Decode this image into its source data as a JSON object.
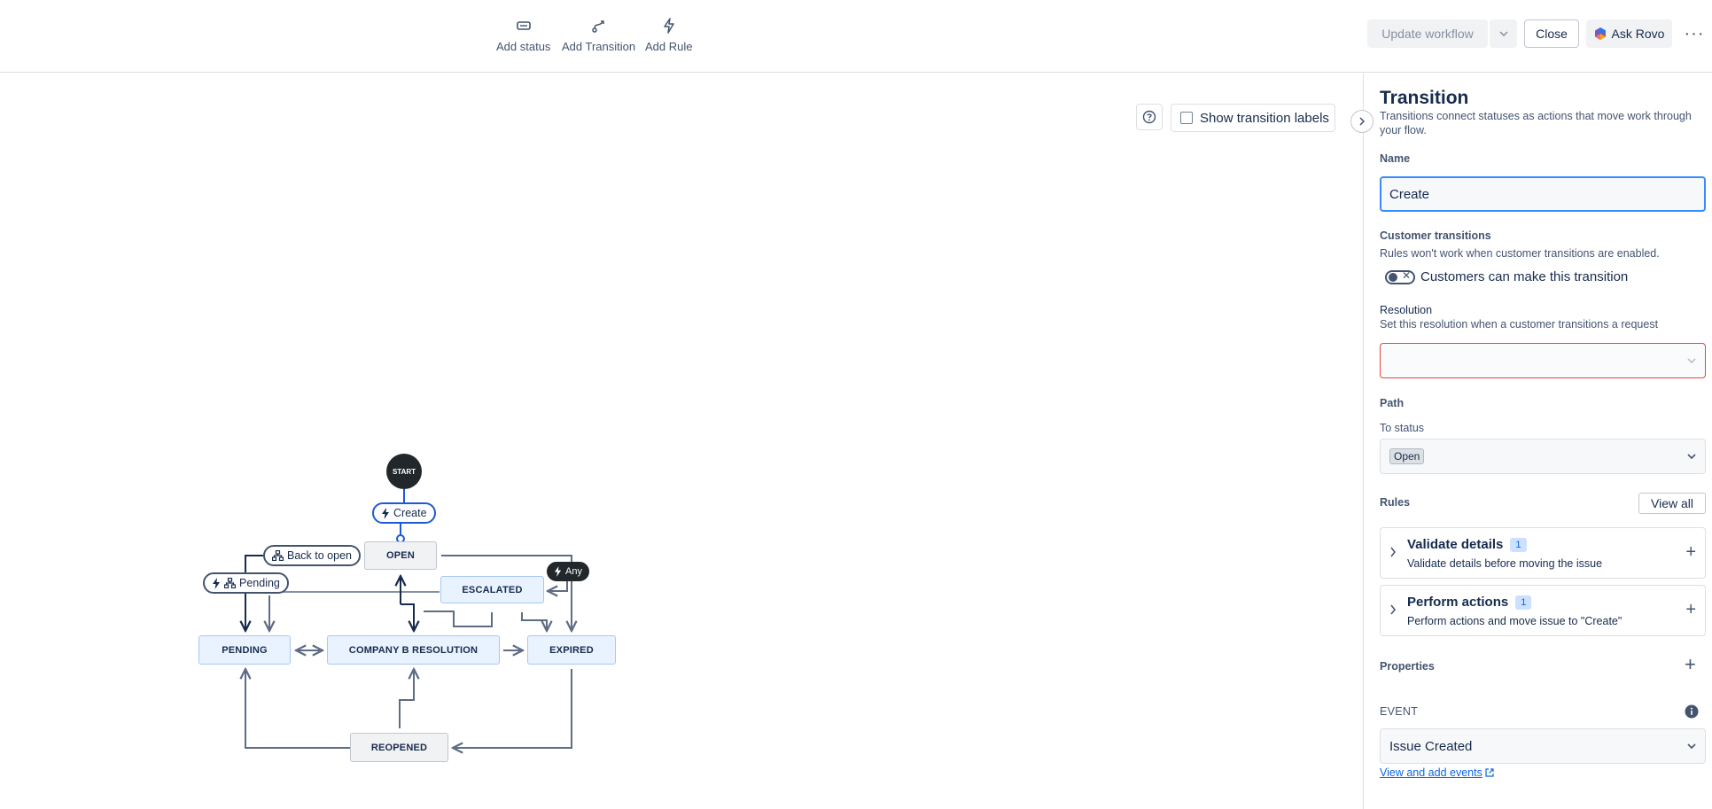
{
  "toolbar": {
    "add_status": "Add status",
    "add_transition": "Add Transition",
    "add_rule": "Add Rule",
    "update_workflow": "Update workflow",
    "close": "Close",
    "ask_rovo": "Ask Rovo",
    "more": "···"
  },
  "canvas": {
    "show_transition_labels": "Show transition labels",
    "help": "?"
  },
  "diagram": {
    "start": "START",
    "create": "Create",
    "back_to_open": "Back to open",
    "pending_transition": "Pending",
    "any": "Any",
    "nodes": {
      "open": "OPEN",
      "escalated": "ESCALATED",
      "pending": "PENDING",
      "company_b_resolution": "COMPANY B RESOLUTION",
      "expired": "EXPIRED",
      "reopened": "REOPENED"
    }
  },
  "panel": {
    "title": "Transition",
    "description": "Transitions connect statuses as actions that move work through your flow.",
    "name_label": "Name",
    "name_value": "Create",
    "customer_transitions_label": "Customer transitions",
    "customer_transitions_desc": "Rules won't work when customer transitions are enabled.",
    "customer_toggle_label": "Customers can make this transition",
    "resolution_label": "Resolution",
    "resolution_desc": "Set this resolution when a customer transitions a request",
    "resolution_value": "",
    "path_label": "Path",
    "to_status_label": "To status",
    "to_status_value": "Open",
    "rules_label": "Rules",
    "view_all": "View all",
    "rules": [
      {
        "title": "Validate details",
        "count": "1",
        "desc": "Validate details before moving the issue"
      },
      {
        "title": "Perform actions",
        "count": "1",
        "desc": "Perform actions and move issue to \"Create\""
      }
    ],
    "properties_label": "Properties",
    "event_label": "EVENT",
    "event_value": "Issue Created",
    "view_events_link": "View and add events"
  },
  "colors": {
    "accent": "#0c66e4",
    "selected_border": "#388bff",
    "error_border": "#e2483d",
    "status_blue_bg": "#e9f2ff",
    "status_grey_bg": "#f1f2f4"
  }
}
